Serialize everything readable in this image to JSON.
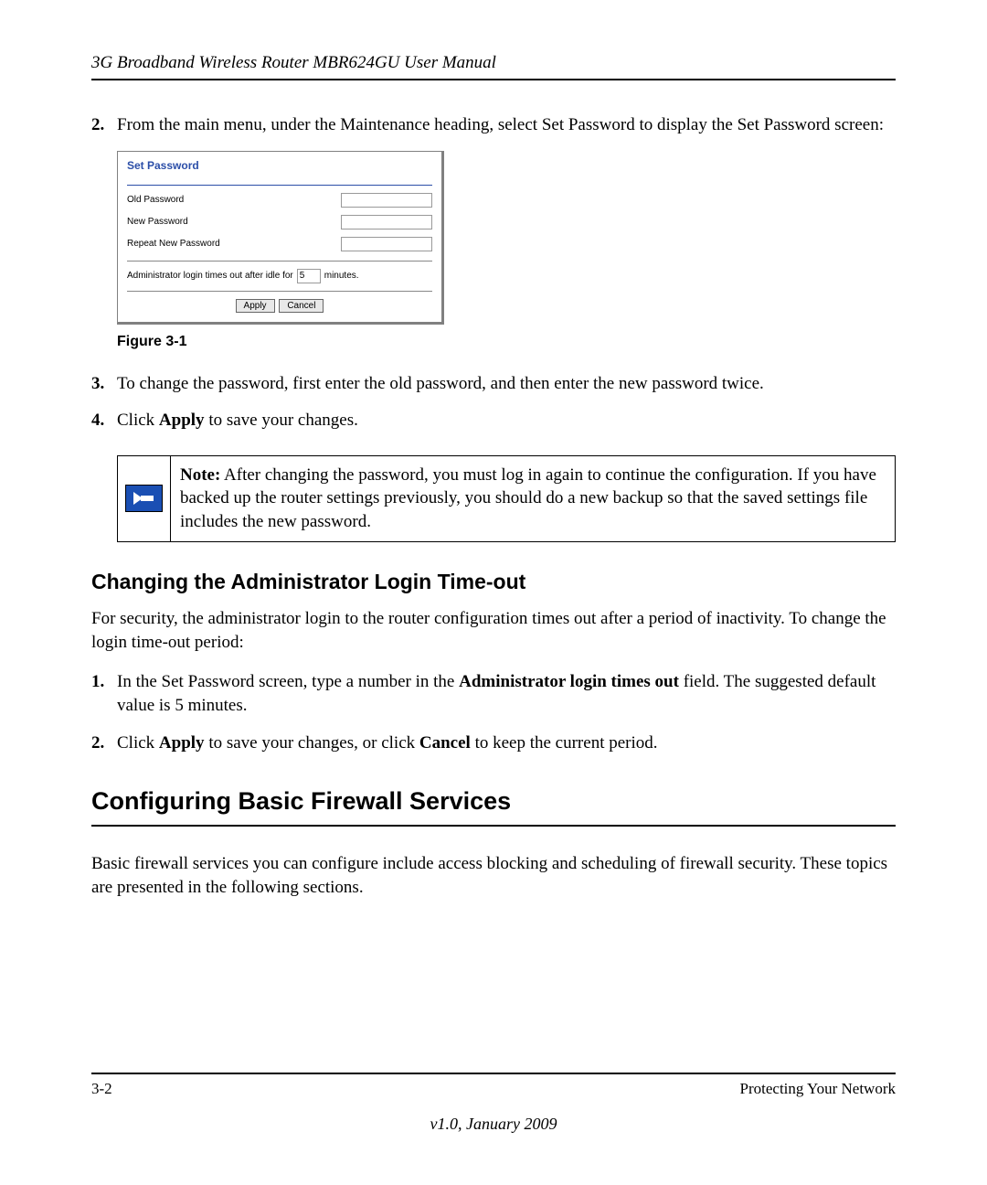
{
  "header": {
    "title": "3G Broadband Wireless Router MBR624GU User Manual"
  },
  "items": {
    "i2": {
      "num": "2.",
      "text": "From the main menu, under the Maintenance heading, select Set Password to display the Set Password screen:"
    },
    "i3": {
      "num": "3.",
      "text": "To change the password, first enter the old password, and then enter the new password twice."
    },
    "i4": {
      "num": "4.",
      "pre": "Click ",
      "bold": "Apply",
      "post": " to save your changes."
    }
  },
  "screenshot": {
    "title": "Set Password",
    "old": "Old Password",
    "new": "New Password",
    "repeat": "Repeat New Password",
    "timeout_pre": "Administrator login times out after idle for",
    "timeout_value": "5",
    "timeout_post": "minutes.",
    "apply": "Apply",
    "cancel": "Cancel"
  },
  "figure": "Figure 3-1",
  "note": {
    "label": "Note:",
    "text": " After changing the password, you must log in again to continue the configuration. If you have backed up the router settings previously, you should do a new backup so that the saved settings file includes the new password."
  },
  "subheading": "Changing the Administrator Login Time-out",
  "para1": "For security, the administrator login to the router configuration times out after a period of inactivity. To change the login time-out period:",
  "sub_items": {
    "s1": {
      "num": "1.",
      "pre": "In the Set Password screen, type a number in the ",
      "bold": "Administrator login times out",
      "post": " field. The suggested default value is 5 minutes."
    },
    "s2": {
      "num": "2.",
      "pre": "Click ",
      "bold1": "Apply",
      "mid": " to save your changes, or click ",
      "bold2": "Cancel",
      "post": " to keep the current period."
    }
  },
  "mainheading": "Configuring Basic Firewall Services",
  "para2": "Basic firewall services you can configure include access blocking and scheduling of firewall security. These topics are presented in the following sections.",
  "footer": {
    "page": "3-2",
    "section": "Protecting Your Network",
    "version": "v1.0, January 2009"
  }
}
